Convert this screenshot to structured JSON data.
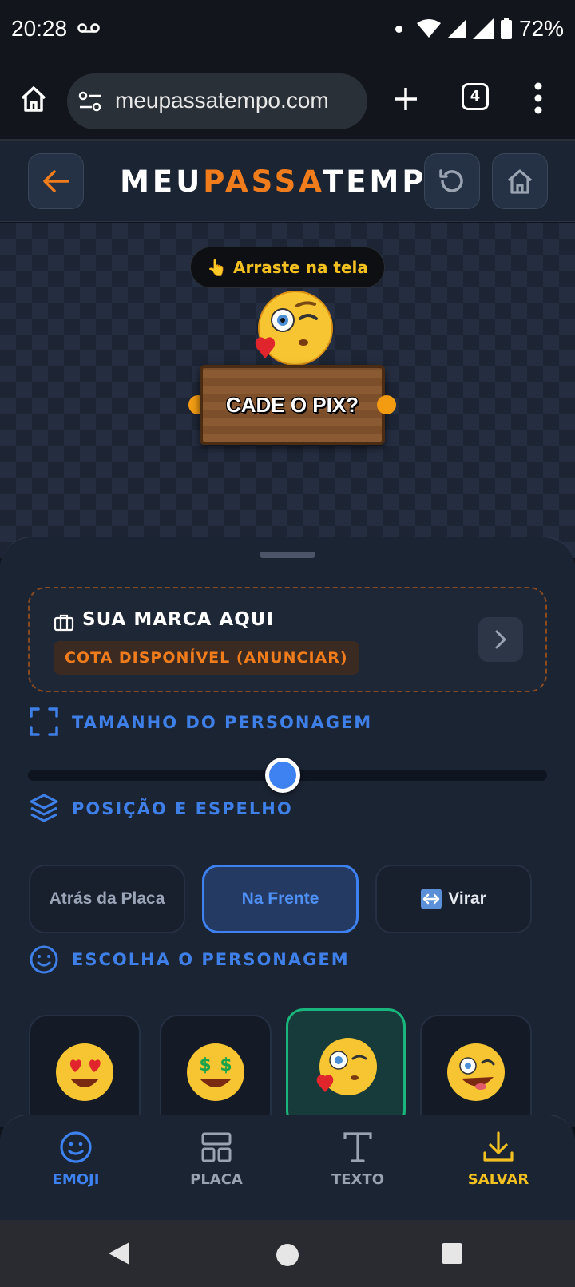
{
  "status_bar": {
    "time": "20:28",
    "battery": "72%"
  },
  "browser": {
    "url": "meupassatempo.com",
    "tab_count": "4"
  },
  "header": {
    "logo_part1": "MEU",
    "logo_part2": "PASSA",
    "logo_part3": "TEMPO"
  },
  "canvas": {
    "drag_hint": "Arraste na tela",
    "sign_text": "CADE O PIX?"
  },
  "ad": {
    "title": "SUA MARCA AQUI",
    "badge": "COTA DISPONÍVEL (ANUNCIAR)"
  },
  "sections": {
    "size": "TAMANHO DO PERSONAGEM",
    "position": "POSIÇÃO E ESPELHO",
    "character": "ESCOLHA O PERSONAGEM"
  },
  "size_slider": {
    "value": 0.49
  },
  "position_buttons": {
    "behind": "Atrás da Placa",
    "front": "Na Frente",
    "flip": "Virar"
  },
  "characters": [
    "heart-eyes-emoji",
    "money-face-emoji",
    "zany-heart-emoji",
    "zany-face-emoji"
  ],
  "bottom_nav": {
    "emoji": "EMOJI",
    "sign": "PLACA",
    "text": "TEXTO",
    "save": "SALVAR"
  },
  "colors": {
    "accent_orange": "#f07c1c",
    "accent_blue": "#3d82f0",
    "save_yellow": "#f2c021",
    "selected_green": "#19b57c"
  }
}
